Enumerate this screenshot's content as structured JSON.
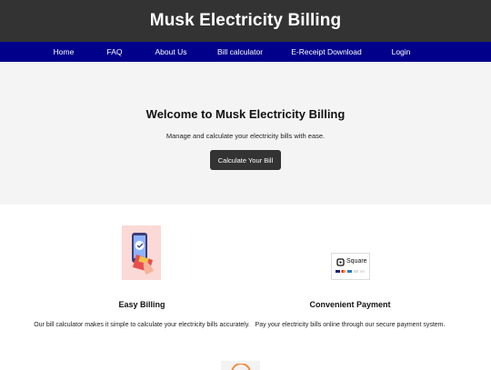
{
  "header": {
    "title": "Musk Electricity Billing"
  },
  "nav": {
    "items": [
      {
        "label": "Home"
      },
      {
        "label": "FAQ"
      },
      {
        "label": "About Us"
      },
      {
        "label": "Bill calculator"
      },
      {
        "label": "E-Receipt Download"
      },
      {
        "label": "Login"
      }
    ]
  },
  "hero": {
    "title": "Welcome to Musk Electricity Billing",
    "subtitle": "Manage and calculate your electricity bills with ease.",
    "button_label": "Calculate Your Bill"
  },
  "features": [
    {
      "title": "Easy Billing",
      "description": "Our bill calculator makes it simple to calculate your electricity bills accurately.",
      "image_icon": "phone-card-payment-icon"
    },
    {
      "title": "Convenient Payment",
      "description": "Pay your electricity bills online through our secure payment system.",
      "image_icon": "square-payment-logo",
      "logo_text": "Square"
    }
  ],
  "colors": {
    "header_bg": "#333333",
    "nav_bg": "#00008b",
    "hero_bg": "#f4f4f4",
    "button_bg": "#333333"
  }
}
